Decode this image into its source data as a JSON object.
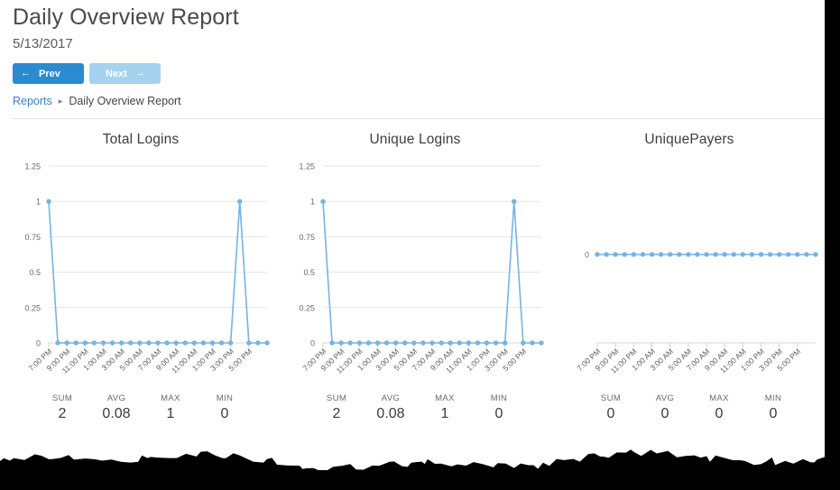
{
  "header": {
    "title": "Daily Overview Report",
    "date": "5/13/2017",
    "prev_label": "Prev",
    "next_label": "Next",
    "prev_arrow": "←",
    "next_arrow": "→"
  },
  "breadcrumb": {
    "root_label": "Reports",
    "separator": "▸",
    "current_label": "Daily Overview Report"
  },
  "stats_keys": {
    "sum": "SUM",
    "avg": "AVG",
    "max": "MAX",
    "min": "MIN"
  },
  "charts": [
    {
      "title": "Total Logins",
      "stats": {
        "sum": "2",
        "avg": "0.08",
        "max": "1",
        "min": "0"
      }
    },
    {
      "title": "Unique Logins",
      "stats": {
        "sum": "2",
        "avg": "0.08",
        "max": "1",
        "min": "0"
      }
    },
    {
      "title": "UniquePayers",
      "stats": {
        "sum": "0",
        "avg": "0",
        "max": "0",
        "min": "0"
      }
    }
  ],
  "chart_data": [
    {
      "type": "line",
      "title": "Total Logins",
      "xlabel": "",
      "ylabel": "",
      "grid": true,
      "legend": "none",
      "line_color": "#74b4e3",
      "marker_color": "#74b4e3",
      "yticks": [
        0,
        0.25,
        0.5,
        0.75,
        1,
        1.25
      ],
      "ytick_labels": [
        "0",
        "0.25",
        "0.5",
        "0.75",
        "1",
        "1.25"
      ],
      "ylim": [
        0,
        1.25
      ],
      "x": [
        "7:00 PM",
        "8:00 PM",
        "9:00 PM",
        "10:00 PM",
        "11:00 PM",
        "12:00 AM",
        "1:00 AM",
        "2:00 AM",
        "3:00 AM",
        "4:00 AM",
        "5:00 AM",
        "6:00 AM",
        "7:00 AM",
        "8:00 AM",
        "9:00 AM",
        "10:00 AM",
        "11:00 AM",
        "12:00 PM",
        "1:00 PM",
        "2:00 PM",
        "3:00 PM",
        "4:00 PM",
        "5:00 PM",
        "6:00 PM",
        "7:00 PM"
      ],
      "xtick_labels": [
        "7:00 PM",
        "9:00 PM",
        "11:00 PM",
        "1:00 AM",
        "3:00 AM",
        "5:00 AM",
        "7:00 AM",
        "9:00 AM",
        "11:00 AM",
        "1:00 PM",
        "3:00 PM",
        "5:00 PM"
      ],
      "values": [
        1,
        0,
        0,
        0,
        0,
        0,
        0,
        0,
        0,
        0,
        0,
        0,
        0,
        0,
        0,
        0,
        0,
        0,
        0,
        0,
        0,
        1,
        0,
        0,
        0
      ]
    },
    {
      "type": "line",
      "title": "Unique Logins",
      "xlabel": "",
      "ylabel": "",
      "grid": true,
      "legend": "none",
      "line_color": "#74b4e3",
      "marker_color": "#74b4e3",
      "yticks": [
        0,
        0.25,
        0.5,
        0.75,
        1,
        1.25
      ],
      "ytick_labels": [
        "0",
        "0.25",
        "0.5",
        "0.75",
        "1",
        "1.25"
      ],
      "ylim": [
        0,
        1.25
      ],
      "x": [
        "7:00 PM",
        "8:00 PM",
        "9:00 PM",
        "10:00 PM",
        "11:00 PM",
        "12:00 AM",
        "1:00 AM",
        "2:00 AM",
        "3:00 AM",
        "4:00 AM",
        "5:00 AM",
        "6:00 AM",
        "7:00 AM",
        "8:00 AM",
        "9:00 AM",
        "10:00 AM",
        "11:00 AM",
        "12:00 PM",
        "1:00 PM",
        "2:00 PM",
        "3:00 PM",
        "4:00 PM",
        "5:00 PM",
        "6:00 PM",
        "7:00 PM"
      ],
      "xtick_labels": [
        "7:00 PM",
        "9:00 PM",
        "11:00 PM",
        "1:00 AM",
        "3:00 AM",
        "5:00 AM",
        "7:00 AM",
        "9:00 AM",
        "11:00 AM",
        "1:00 PM",
        "3:00 PM",
        "5:00 PM"
      ],
      "values": [
        1,
        0,
        0,
        0,
        0,
        0,
        0,
        0,
        0,
        0,
        0,
        0,
        0,
        0,
        0,
        0,
        0,
        0,
        0,
        0,
        0,
        1,
        0,
        0,
        0
      ]
    },
    {
      "type": "line",
      "title": "UniquePayers",
      "xlabel": "",
      "ylabel": "",
      "grid": false,
      "legend": "none",
      "line_color": "#74b4e3",
      "marker_color": "#74b4e3",
      "yticks": [
        0
      ],
      "ytick_labels": [
        "0"
      ],
      "ylim": [
        0,
        0
      ],
      "x": [
        "7:00 PM",
        "8:00 PM",
        "9:00 PM",
        "10:00 PM",
        "11:00 PM",
        "12:00 AM",
        "1:00 AM",
        "2:00 AM",
        "3:00 AM",
        "4:00 AM",
        "5:00 AM",
        "6:00 AM",
        "7:00 AM",
        "8:00 AM",
        "9:00 AM",
        "10:00 AM",
        "11:00 AM",
        "12:00 PM",
        "1:00 PM",
        "2:00 PM",
        "3:00 PM",
        "4:00 PM",
        "5:00 PM",
        "6:00 PM",
        "7:00 PM"
      ],
      "xtick_labels": [
        "7:00 PM",
        "9:00 PM",
        "11:00 PM",
        "1:00 AM",
        "3:00 AM",
        "5:00 AM",
        "7:00 AM",
        "9:00 AM",
        "11:00 AM",
        "1:00 PM",
        "3:00 PM",
        "5:00 PM"
      ],
      "values": [
        0,
        0,
        0,
        0,
        0,
        0,
        0,
        0,
        0,
        0,
        0,
        0,
        0,
        0,
        0,
        0,
        0,
        0,
        0,
        0,
        0,
        0,
        0,
        0,
        0
      ]
    }
  ],
  "colors": {
    "accent": "#2a8bd0",
    "accent_disabled": "#a6d2ef",
    "link": "#3a7fc4",
    "chart_line": "#74b4e3",
    "grid": "#e6e6e6"
  }
}
